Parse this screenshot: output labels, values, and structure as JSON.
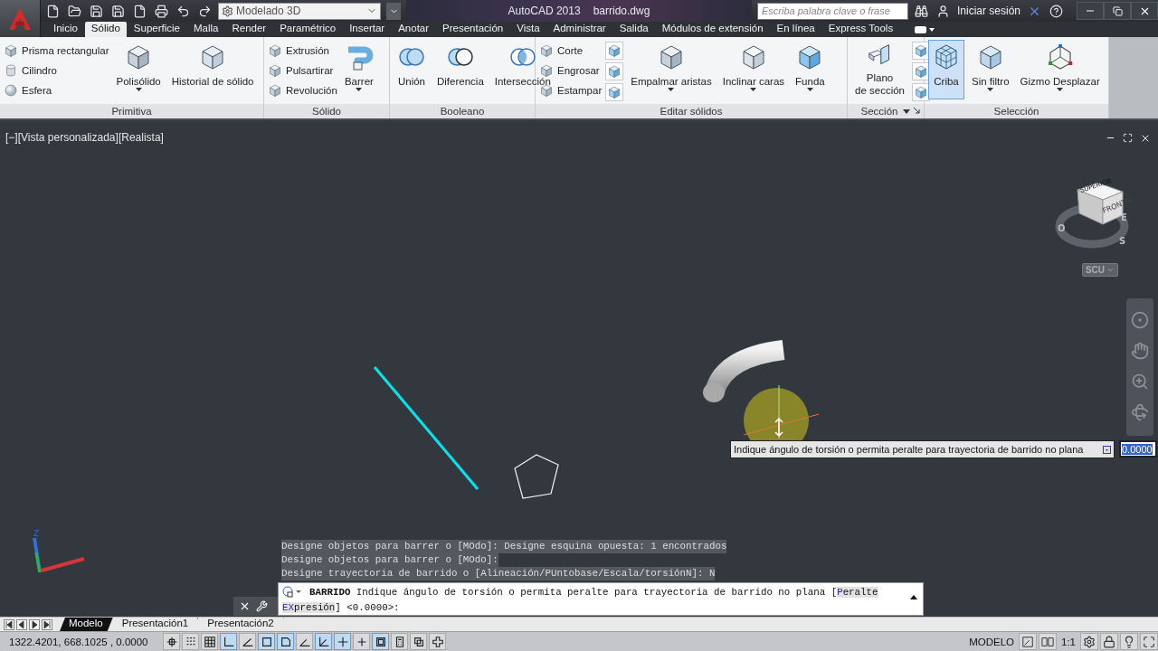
{
  "title_bar": {
    "workspace": "Modelado 3D",
    "app_name": "AutoCAD 2013",
    "file_name": "barrido.dwg",
    "search": {
      "placeholder": "Escriba palabra clave o frase"
    },
    "sign_in": "Iniciar sesión"
  },
  "tabs": [
    {
      "label": "Inicio",
      "selected": false
    },
    {
      "label": "Sólido",
      "selected": true
    },
    {
      "label": "Superficie",
      "selected": false
    },
    {
      "label": "Malla",
      "selected": false
    },
    {
      "label": "Render",
      "selected": false
    },
    {
      "label": "Paramétrico",
      "selected": false
    },
    {
      "label": "Insertar",
      "selected": false
    },
    {
      "label": "Anotar",
      "selected": false
    },
    {
      "label": "Presentación",
      "selected": false
    },
    {
      "label": "Vista",
      "selected": false
    },
    {
      "label": "Administrar",
      "selected": false
    },
    {
      "label": "Salida",
      "selected": false
    },
    {
      "label": "Módulos de extensión",
      "selected": false
    },
    {
      "label": "En línea",
      "selected": false
    },
    {
      "label": "Express Tools",
      "selected": false
    }
  ],
  "ribbon": {
    "panels": [
      {
        "title": "Primitiva",
        "menu": false,
        "groups": [
          {
            "kind": "list",
            "items": [
              "Prisma rectangular",
              "Cilindro",
              "Esfera"
            ]
          },
          {
            "kind": "large",
            "label": "Polisólido",
            "dropdown": true,
            "selected": false
          },
          {
            "kind": "large",
            "label": "Historial de sólido",
            "dropdown": false,
            "selected": false
          }
        ]
      },
      {
        "title": "Sólido",
        "menu": false,
        "groups": [
          {
            "kind": "list",
            "items": [
              "Extrusión",
              "Pulsartirar",
              "Revolución"
            ]
          },
          {
            "kind": "large",
            "label": "Barrer",
            "dropdown": true,
            "selected": false
          }
        ]
      },
      {
        "title": "Booleano",
        "menu": false,
        "groups": [
          {
            "kind": "large",
            "label": "Unión",
            "dropdown": false,
            "selected": false
          },
          {
            "kind": "large",
            "label": "Diferencia",
            "dropdown": false,
            "selected": false
          },
          {
            "kind": "large",
            "label": "Intersección",
            "dropdown": false,
            "selected": false
          }
        ]
      },
      {
        "title": "Editar sólidos",
        "menu": false,
        "groups": [
          {
            "kind": "list",
            "items": [
              "Corte",
              "Engrosar",
              "Estampar"
            ]
          },
          {
            "kind": "icons"
          },
          {
            "kind": "large",
            "label": "Empalmar aristas",
            "dropdown": true,
            "selected": false
          },
          {
            "kind": "large",
            "label": "Inclinar caras",
            "dropdown": true,
            "selected": false
          },
          {
            "kind": "large",
            "label": "Funda",
            "dropdown": true,
            "selected": false
          }
        ]
      },
      {
        "title": "Sección",
        "menu": true,
        "groups": [
          {
            "kind": "large",
            "label": "Plano\nde sección",
            "dropdown": false,
            "selected": false
          },
          {
            "kind": "icons"
          }
        ]
      },
      {
        "title": "Selección",
        "menu": false,
        "groups": [
          {
            "kind": "large",
            "label": "Criba",
            "dropdown": false,
            "selected": true
          },
          {
            "kind": "large",
            "label": "Sin filtro",
            "dropdown": true,
            "selected": false
          },
          {
            "kind": "large",
            "label": "Gizmo Desplazar",
            "dropdown": true,
            "selected": false
          }
        ]
      }
    ]
  },
  "viewport": {
    "controls": [
      "[−]",
      "[Vista personalizada]",
      "[Realista]"
    ],
    "viewcube": {
      "top": "SUPERIOR",
      "front": "FRONTAL",
      "compass": [
        "O",
        "S",
        "E"
      ]
    },
    "ucs_menu": "SCU",
    "ucs_axis": "Z",
    "tooltip": {
      "text": "Indique ángulo de torsión o permita peralte para trayectoria de barrido no plana",
      "value": "0.0000"
    }
  },
  "command": {
    "history": [
      "Designe objetos para barrer o [MOdo]: Designe esquina opuesta: 1 encontrados",
      "Designe objetos para barrer o [MOdo]:",
      "Designe trayectoria de barrido o [Alineación/PUntobase/Escala/torsiónN]: N"
    ],
    "name": "BARRIDO",
    "prompt": "Indique ángulo de torsión o permita peralte para trayectoria de barrido no plana [",
    "options": [
      {
        "key": "P",
        "rest": "eralte"
      },
      {
        "key": "EX",
        "rest": "presión"
      }
    ],
    "suffix": "] <0.0000>:"
  },
  "layout_tabs": [
    {
      "label": "Modelo",
      "selected": true
    },
    {
      "label": "Presentación1",
      "selected": false
    },
    {
      "label": "Presentación2",
      "selected": false
    }
  ],
  "status_bar": {
    "coordinates": "1322.4201, 668.1025 , 0.0000",
    "toggles": [
      {
        "on": false
      },
      {
        "on": false
      },
      {
        "on": false
      },
      {
        "on": true
      },
      {
        "on": false
      },
      {
        "on": true
      },
      {
        "on": true
      },
      {
        "on": false
      },
      {
        "on": true
      },
      {
        "on": true
      },
      {
        "on": false
      },
      {
        "on": true
      },
      {
        "on": false
      },
      {
        "on": false
      },
      {
        "on": false
      }
    ],
    "space": "MODELO",
    "scale": "1:1"
  }
}
